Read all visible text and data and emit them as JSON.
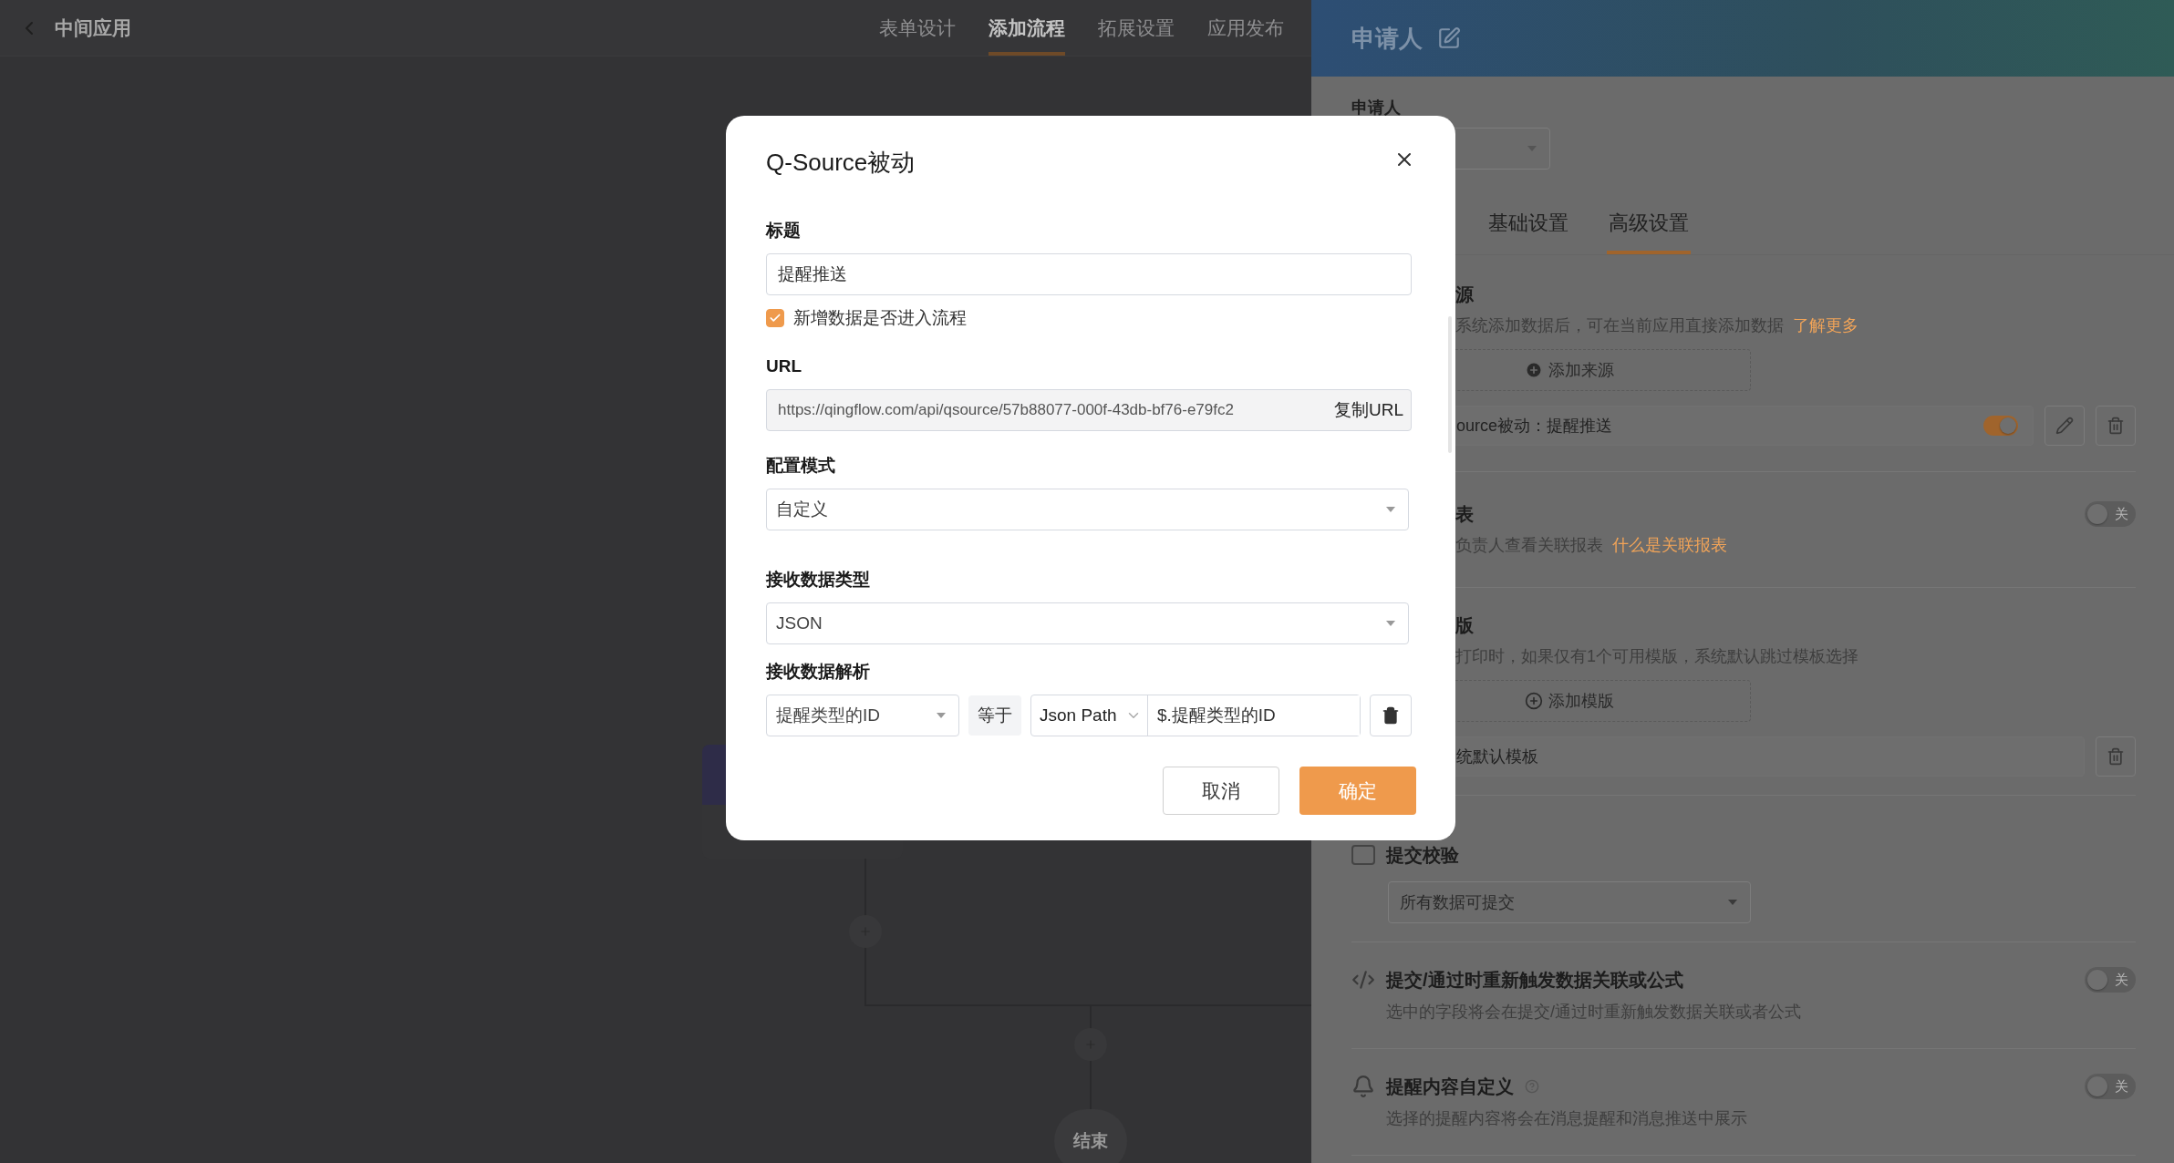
{
  "header": {
    "back_title": "中间应用",
    "tabs": [
      {
        "label": "表单设计",
        "selected": false
      },
      {
        "label": "添加流程",
        "selected": true
      },
      {
        "label": "拓展设置",
        "selected": false
      },
      {
        "label": "应用发布",
        "selected": false
      }
    ]
  },
  "flow": {
    "end_node": "结束"
  },
  "panel": {
    "title": "申请人",
    "field_label": "申请人",
    "tabs": [
      {
        "label": "基础设置",
        "selected": false
      },
      {
        "label": "高级设置",
        "selected": true
      }
    ],
    "data_source": {
      "title": "源",
      "description": "系统添加数据后，可在当前应用直接添加数据",
      "link": "了解更多",
      "add_button": "添加来源",
      "items": [
        {
          "label": "ource被动：提醒推送",
          "on": true
        }
      ]
    },
    "related_report": {
      "title": "表",
      "description": "负责人查看关联报表",
      "link": "什么是关联报表",
      "toggle": {
        "on": false,
        "label": "关"
      }
    },
    "print_template": {
      "title": "版",
      "description": "打印时，如果仅有1个可用模版，系统默认跳过模板选择",
      "add_button": "添加模版",
      "items": [
        {
          "label": "统默认模板"
        }
      ]
    },
    "submit_check": {
      "title": "提交校验",
      "select": "所有数据可提交"
    },
    "retrigger": {
      "title": "提交/通过时重新触发数据关联或公式",
      "description": "选中的字段将会在提交/通过时重新触发数据关联或者公式",
      "toggle": {
        "on": false,
        "label": "关"
      }
    },
    "reminder": {
      "title": "提醒内容自定义",
      "description": "选择的提醒内容将会在消息提醒和消息推送中展示",
      "toggle": {
        "on": false,
        "label": "关"
      }
    }
  },
  "dialog": {
    "title": "Q-Source被动",
    "fields": [
      {
        "kind": "text",
        "label": "标题",
        "value": "提醒推送"
      },
      {
        "kind": "checkbox",
        "label": "新增数据是否进入流程",
        "checked": true
      },
      {
        "kind": "url",
        "label": "URL",
        "value": "https://qingflow.com/api/qsource/57b88077-000f-43db-bf76-e79fc2",
        "action": "复制URL"
      },
      {
        "kind": "select",
        "label": "配置模式",
        "value": "自定义"
      },
      {
        "kind": "select",
        "label": "接收数据类型",
        "value": "JSON"
      },
      {
        "kind": "mapping",
        "label": "接收数据解析",
        "field": "提醒类型的ID",
        "operator": "等于",
        "source": "Json Path",
        "path": "$.提醒类型的ID"
      }
    ],
    "buttons": [
      {
        "label": "取消",
        "kind": "secondary"
      },
      {
        "label": "确定",
        "kind": "primary"
      }
    ]
  }
}
